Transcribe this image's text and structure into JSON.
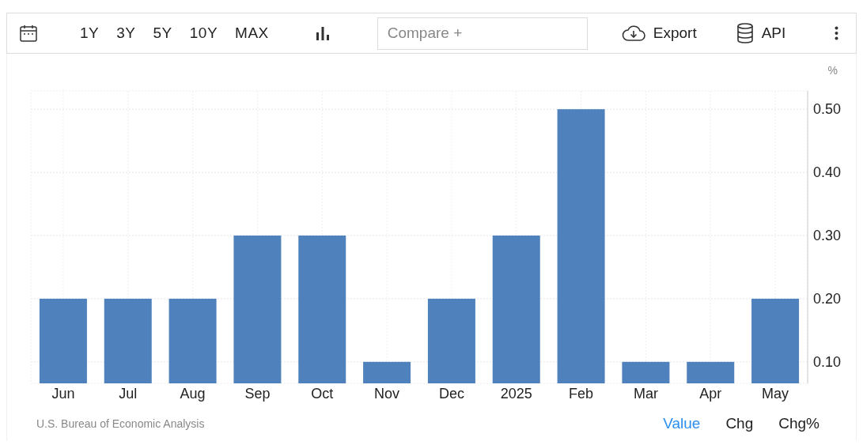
{
  "toolbar": {
    "ranges": [
      {
        "label": "1Y",
        "selected": false
      },
      {
        "label": "3Y",
        "selected": false
      },
      {
        "label": "5Y",
        "selected": false
      },
      {
        "label": "10Y",
        "selected": false
      },
      {
        "label": "MAX",
        "selected": false
      }
    ],
    "compare": {
      "placeholder": "Compare +"
    },
    "export": "Export",
    "api": "API"
  },
  "chart": {
    "unit": "%",
    "chart_data": {
      "type": "bar",
      "categories": [
        "Jun",
        "Jul",
        "Aug",
        "Sep",
        "Oct",
        "Nov",
        "Dec",
        "2025",
        "Feb",
        "Mar",
        "Apr",
        "May"
      ],
      "grid": true,
      "series": [
        {
          "color": "#4f81bd",
          "values": [
            0.2,
            0.2,
            0.2,
            0.3,
            0.3,
            0.1,
            0.2,
            0.3,
            0.5,
            0.1,
            0.1,
            0.2
          ]
        }
      ],
      "ylim": [
        0.066,
        0.529
      ],
      "yticks": [
        {
          "value": 0.1,
          "label": "0.10"
        },
        {
          "value": 0.2,
          "label": "0.20"
        },
        {
          "value": 0.3,
          "label": "0.30"
        },
        {
          "value": 0.4,
          "label": "0.40"
        },
        {
          "value": 0.5,
          "label": "0.50"
        }
      ]
    }
  },
  "footer": {
    "source": "U.S. Bureau of Economic Analysis",
    "views": [
      {
        "label": "Value",
        "selected": true
      },
      {
        "label": "Chg",
        "selected": false
      },
      {
        "label": "Chg%",
        "selected": false
      }
    ]
  }
}
